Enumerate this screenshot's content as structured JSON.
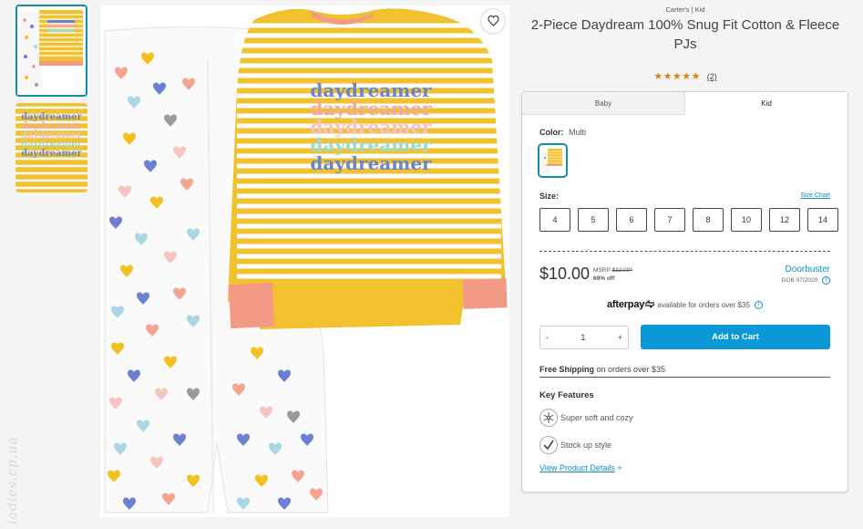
{
  "product": {
    "brand_line": "Carter's | Kid",
    "title": "2-Piece Daydream 100% Snug Fit Cotton & Fleece PJs",
    "rating_stars": "★★★★★",
    "rating_count": "(2)"
  },
  "image": {
    "shirt_text": [
      "daydreamer",
      "daydreamer",
      "daydreamer",
      "daydreamer",
      "daydreamer"
    ],
    "shirt_text_colors": [
      "#6b85c9",
      "#f0a9a3",
      "#f3c1c7",
      "#9ed9c9",
      "#6b85c9"
    ],
    "stripe_color": "#f2c12e",
    "cuff_color": "#f29a85",
    "heart_colors": [
      "#f5a48f",
      "#6d7fd0",
      "#f2c01f",
      "#a9d7e6",
      "#9a9a9a",
      "#f7c5c1"
    ],
    "watermark": "ladies.cp.ua"
  },
  "icons": {
    "favorite": "heart-outline-icon"
  },
  "tabs": [
    {
      "label": "Baby"
    },
    {
      "label": "Kid"
    }
  ],
  "color": {
    "label": "Color:",
    "value": "Multi"
  },
  "size": {
    "label": "Size:",
    "chart_link": "Size Chart",
    "options": [
      "4",
      "5",
      "6",
      "7",
      "8",
      "10",
      "12",
      "14"
    ]
  },
  "pricing": {
    "price": "$10.00",
    "msrp_label": "MSRP",
    "msrp_value": "$32.00*",
    "discount": "69% off",
    "badge": "Doorbuster",
    "badge_sub": "DOB 07/2020"
  },
  "afterpay": {
    "logo": "afterpay",
    "text": "available for orders over $35"
  },
  "cart": {
    "qty_minus": "-",
    "qty_value": "1",
    "qty_plus": "+",
    "add_button": "Add to Cart"
  },
  "shipping": {
    "bold": "Free Shipping",
    "rest": "on orders over $35"
  },
  "features": {
    "title": "Key Features",
    "items": [
      {
        "label": "Super soft and cozy",
        "icon": "snowflake-icon"
      },
      {
        "label": "Stock up style",
        "icon": "checkmark-icon"
      }
    ],
    "details_link": "View Product Details",
    "details_plus": "+"
  },
  "colors": {
    "accent": "#0a98d6",
    "link": "#0a8fc2",
    "star": "#d98214",
    "selected_border": "#0f8fa8"
  }
}
